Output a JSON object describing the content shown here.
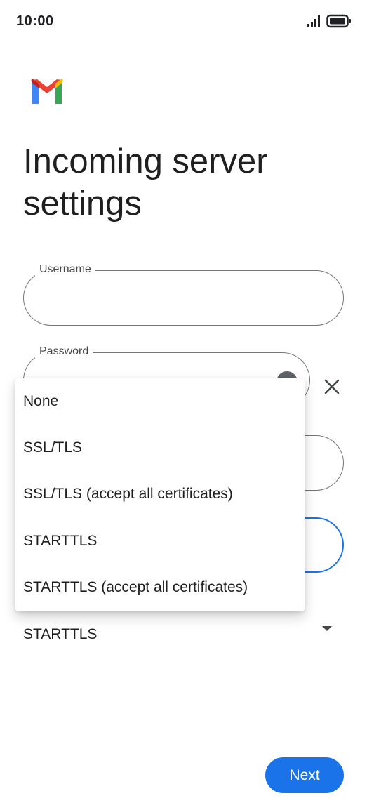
{
  "status_bar": {
    "time": "10:00",
    "icons": [
      "signal-icon",
      "battery-icon"
    ]
  },
  "logo": {
    "name": "gmail-logo-icon",
    "colors": [
      "#ea4335",
      "#4285f4",
      "#34a853",
      "#fbbc04",
      "#c5221f"
    ]
  },
  "page": {
    "title": "Incoming server settings"
  },
  "form": {
    "username_label": "Username",
    "password_label": "Password",
    "security_value": "STARTTLS"
  },
  "dropdown": {
    "options": [
      "None",
      "SSL/TLS",
      "SSL/TLS (accept all certificates)",
      "STARTTLS",
      "STARTTLS (accept all certificates)"
    ]
  },
  "actions": {
    "next_label": "Next"
  },
  "colors": {
    "accent": "#1a73e8",
    "outline": "#747775"
  }
}
